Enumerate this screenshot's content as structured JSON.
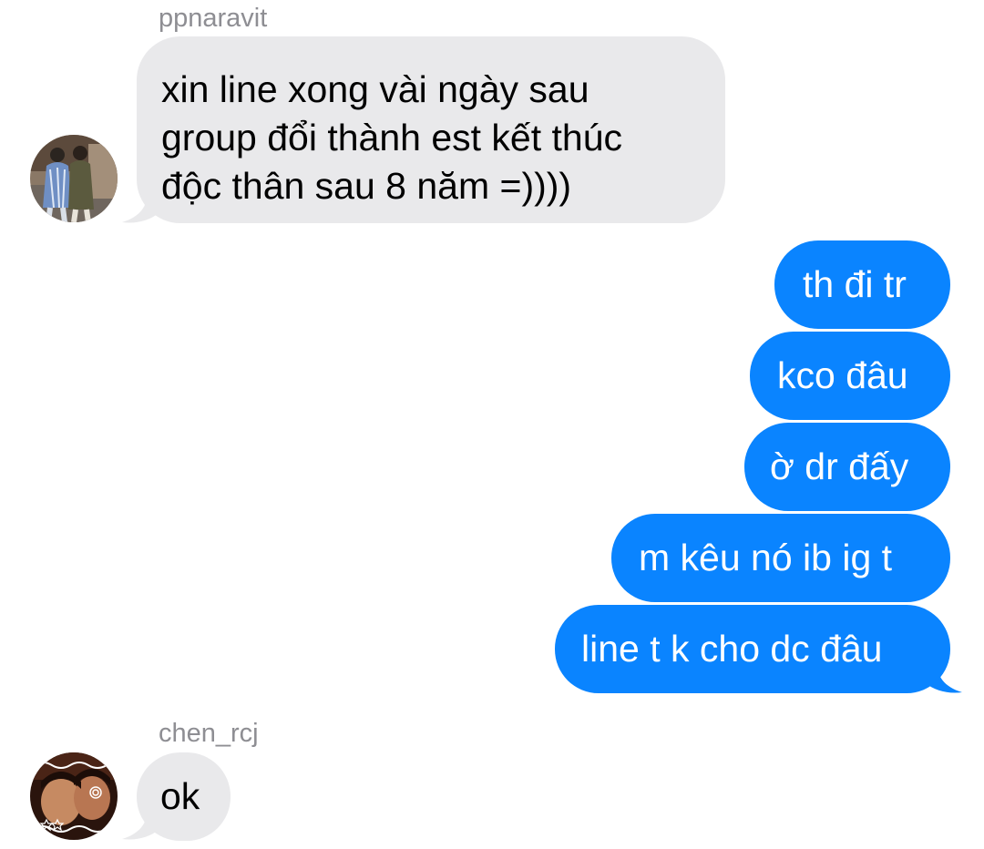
{
  "colors": {
    "incoming_bubble": "#e9e9eb",
    "outgoing_bubble": "#0a84ff",
    "sender_label": "#8e8e93"
  },
  "conversation": {
    "group1": {
      "sender": "ppnaravit",
      "avatar_icon": "user-avatar-photo-icon",
      "message": "xin line xong vài ngày sau\ngroup đổi thành est kết thúc\nđộc thân sau 8 năm =))))"
    },
    "outgoing": [
      "th đi tr",
      "kco đâu",
      "ờ dr đấy",
      "m kêu nó ib ig t",
      "line t k cho dc đâu"
    ],
    "group2": {
      "sender": "chen_rcj",
      "avatar_icon": "user-avatar-photo-icon",
      "message": "ok"
    }
  }
}
